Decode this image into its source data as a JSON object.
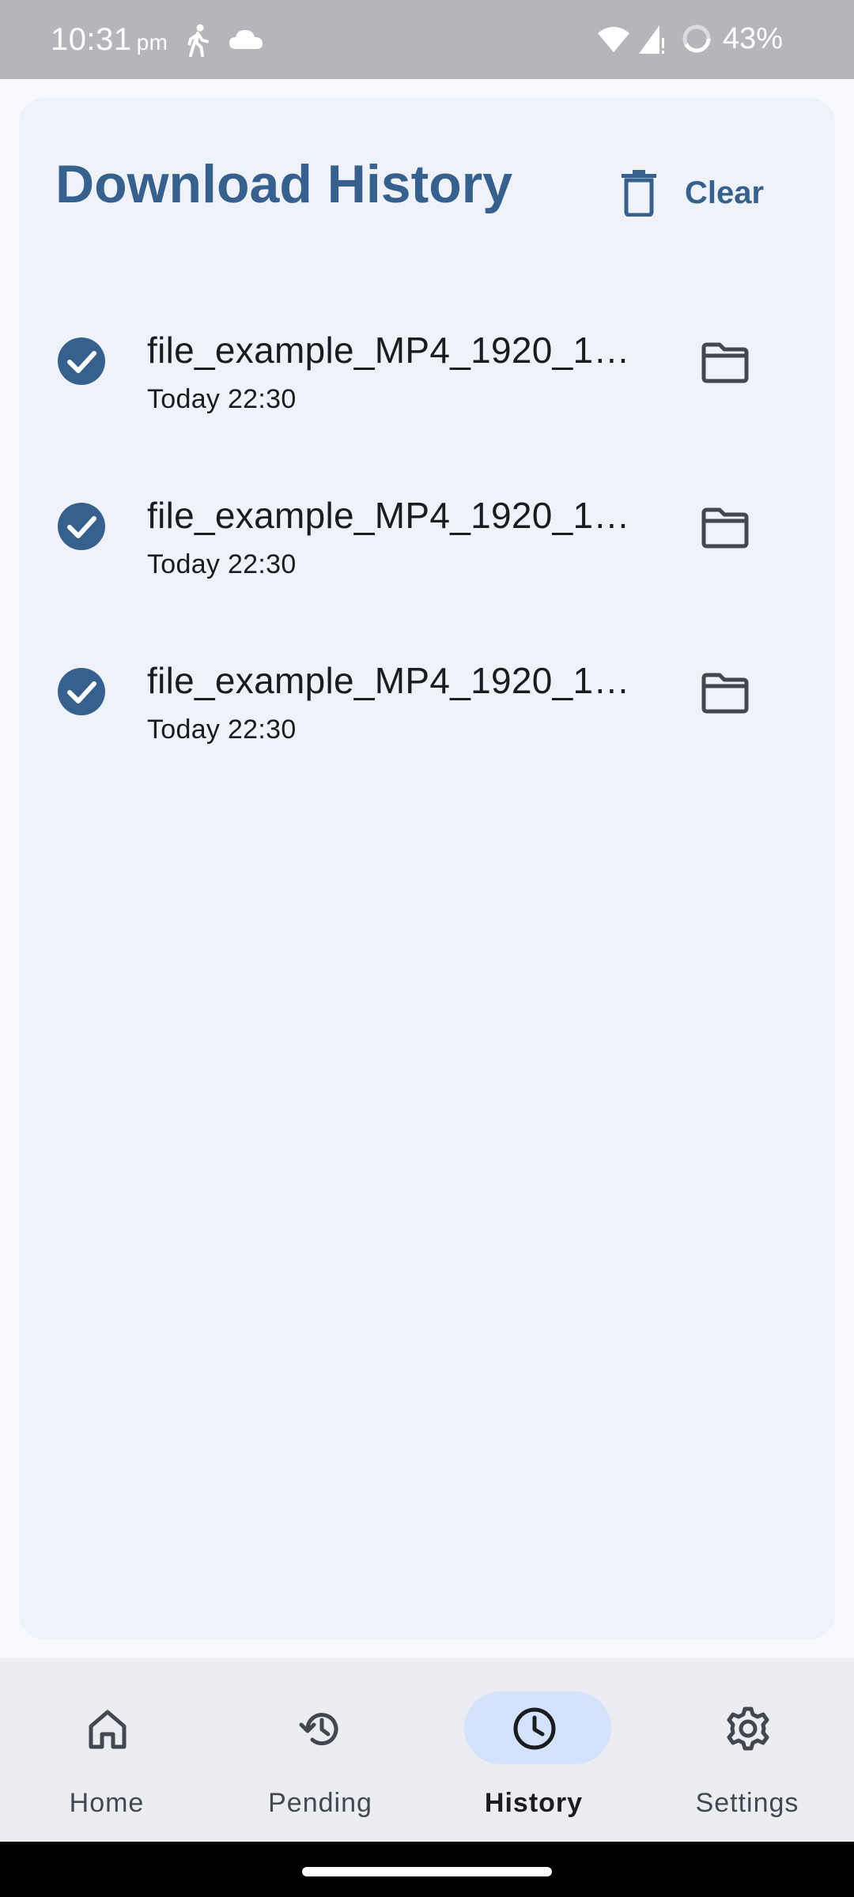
{
  "status_bar": {
    "time": "10:31",
    "ampm": "pm",
    "battery": "43%"
  },
  "header": {
    "title": "Download History",
    "clear_label": "Clear"
  },
  "history": [
    {
      "name": "file_example_MP4_1920_1…",
      "date": "Today 22:30"
    },
    {
      "name": "file_example_MP4_1920_1…",
      "date": "Today 22:30"
    },
    {
      "name": "file_example_MP4_1920_1…",
      "date": "Today 22:30"
    }
  ],
  "nav": [
    {
      "label": "Home",
      "icon": "home-icon"
    },
    {
      "label": "Pending",
      "icon": "history-restore-icon"
    },
    {
      "label": "History",
      "icon": "clock-icon",
      "active": true
    },
    {
      "label": "Settings",
      "icon": "gear-icon"
    }
  ],
  "colors": {
    "accent": "#36618e",
    "card": "#f0f2fa",
    "nav_active": "#d3e3fd"
  }
}
